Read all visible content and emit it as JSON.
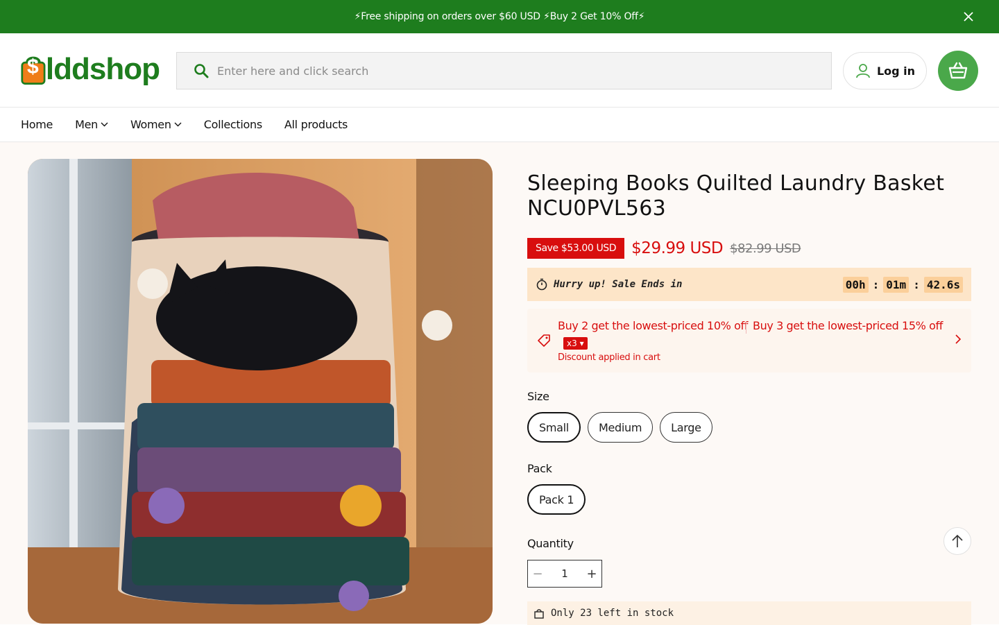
{
  "announcement": {
    "text": "⚡Free shipping on orders over $60 USD ⚡Buy 2 Get 10% Off⚡"
  },
  "header": {
    "logo_prefix": "",
    "logo_a": "lddsh",
    "logo_b": "op",
    "logo_dollar": "$",
    "search_placeholder": "Enter here and click search",
    "login_label": "Log in"
  },
  "nav": {
    "items": [
      {
        "label": "Home",
        "dropdown": false
      },
      {
        "label": "Men",
        "dropdown": true
      },
      {
        "label": "Women",
        "dropdown": true
      },
      {
        "label": "Collections",
        "dropdown": false
      },
      {
        "label": "All products",
        "dropdown": false
      }
    ]
  },
  "product": {
    "title": "Sleeping Books Quilted Laundry Basket NCU0PVL563",
    "save_badge": "Save $53.00 USD",
    "price": "$29.99 USD",
    "compare_price": "$82.99 USD",
    "timer": {
      "label": "Hurry up! Sale Ends in",
      "hours": "00h",
      "minutes": "01m",
      "seconds": "42.6s",
      "separator": ":"
    },
    "promo": {
      "deal_1": "Buy 2 get the lowest-priced 10% off",
      "deal_2": "Buy 3 get the lowest-priced 15% off",
      "multiplier": "x3",
      "applied": "Discount applied in cart"
    },
    "size_label": "Size",
    "sizes": [
      "Small",
      "Medium",
      "Large"
    ],
    "selected_size": "Small",
    "pack_label": "Pack",
    "packs": [
      "Pack 1"
    ],
    "selected_pack": "Pack 1",
    "quantity_label": "Quantity",
    "quantity": "1",
    "stock_text": "Only 23 left in stock"
  },
  "colors": {
    "announcement_bg": "#1e7d1e",
    "brand_green": "#4aa84a",
    "sale_red": "#d80e0e",
    "logo_orange": "#ef7d18"
  }
}
